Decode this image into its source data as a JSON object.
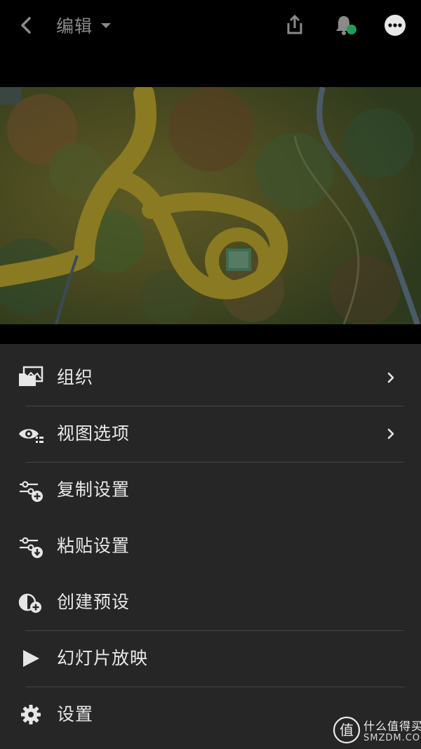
{
  "header": {
    "title": "编辑",
    "icons": [
      "back-arrow-icon",
      "caret-down-icon",
      "share-icon",
      "bell-icon",
      "more-icon"
    ],
    "notification_dot_color": "#1f9d5a"
  },
  "menu": {
    "items": [
      {
        "label": "组织",
        "icon": "organize-icon",
        "has_chevron": true
      },
      {
        "label": "视图选项",
        "icon": "view-options-icon",
        "has_chevron": true
      },
      {
        "label": "复制设置",
        "icon": "copy-settings-icon",
        "has_chevron": false
      },
      {
        "label": "粘贴设置",
        "icon": "paste-settings-icon",
        "has_chevron": false
      },
      {
        "label": "创建预设",
        "icon": "create-preset-icon",
        "has_chevron": false
      },
      {
        "label": "幻灯片放映",
        "icon": "slideshow-icon",
        "has_chevron": false
      },
      {
        "label": "设置",
        "icon": "settings-gear-icon",
        "has_chevron": false
      }
    ]
  },
  "watermark": {
    "logo_char": "值",
    "line1": "什么值得买",
    "line2": "SMZDM.COM"
  },
  "colors": {
    "background": "#000000",
    "sheet": "#262626",
    "divider": "#464646",
    "text": "#e9e9e9",
    "title_text": "#8a8a8a"
  }
}
